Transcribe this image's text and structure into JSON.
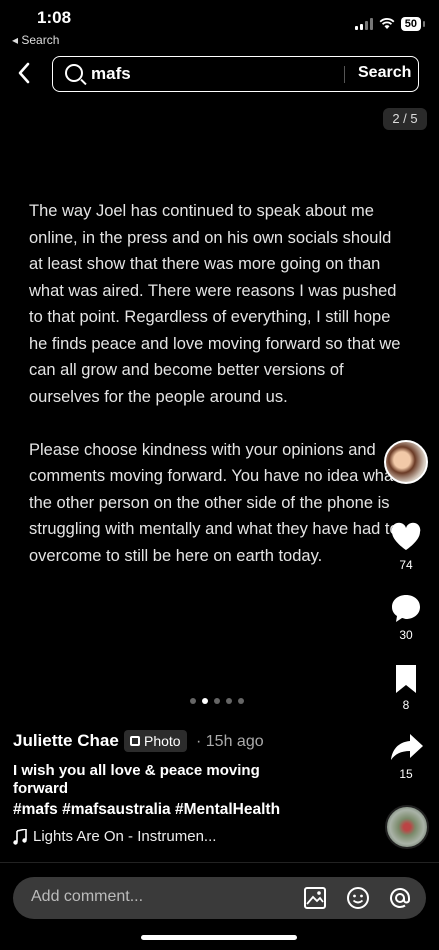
{
  "status": {
    "time": "1:08",
    "back_app": "◂ Search",
    "battery": "50"
  },
  "search": {
    "query": "mafs",
    "button_label": "Search"
  },
  "page_counter": "2 / 5",
  "post_text": "The way Joel has continued to speak about me online, in the press and on his own socials should at least show that there was more going on than what was aired. There were reasons I was pushed to that point. Regardless of everything, I still hope he finds peace and love moving forward so that we can all grow and become better versions of ourselves for the people around us.\n\nPlease choose kindness with your opinions and comments moving forward. You have no idea what the other person on the other side of the phone is struggling with mentally and what they have had to overcome to still be here on earth today.",
  "actions": {
    "likes": "74",
    "comments": "30",
    "saves": "8",
    "shares": "15"
  },
  "carousel": {
    "total": 5,
    "active": 1
  },
  "author": {
    "name": "Juliette Chae",
    "type_badge": "Photo",
    "time_ago": "· 15h ago"
  },
  "caption": "I wish you all love & peace moving forward",
  "hashtags": "#mafs #mafsaustralia #MentalHealth",
  "music": "Lights Are On - Instrumen...",
  "comment": {
    "placeholder": "Add comment..."
  }
}
